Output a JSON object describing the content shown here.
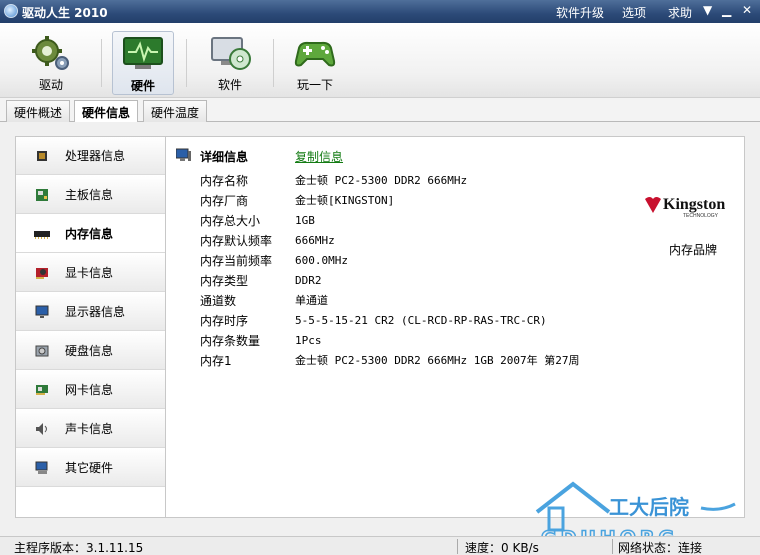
{
  "window": {
    "title": "驱动人生 2010",
    "menu": [
      "软件升级",
      "选项",
      "求助"
    ]
  },
  "toolbar": {
    "items": [
      {
        "label": "驱动",
        "icon": "gears-icon"
      },
      {
        "label": "硬件",
        "icon": "monitor-pulse-icon"
      },
      {
        "label": "软件",
        "icon": "monitor-disc-icon"
      },
      {
        "label": "玩一下",
        "icon": "gamepad-icon"
      }
    ],
    "active": "硬件"
  },
  "tabs": [
    "硬件概述",
    "硬件信息",
    "硬件温度"
  ],
  "sidebar": {
    "items": [
      {
        "label": "处理器信息",
        "icon": "cpu-icon"
      },
      {
        "label": "主板信息",
        "icon": "motherboard-icon"
      },
      {
        "label": "内存信息",
        "icon": "memory-icon"
      },
      {
        "label": "显卡信息",
        "icon": "graphics-card-icon"
      },
      {
        "label": "显示器信息",
        "icon": "display-icon"
      },
      {
        "label": "硬盘信息",
        "icon": "hard-disk-icon"
      },
      {
        "label": "网卡信息",
        "icon": "network-card-icon"
      },
      {
        "label": "声卡信息",
        "icon": "speaker-icon"
      },
      {
        "label": "其它硬件",
        "icon": "computer-icon"
      }
    ],
    "active": "内存信息"
  },
  "details": {
    "title": "详细信息",
    "copy_label": "复制信息",
    "rows": [
      {
        "label": "内存名称",
        "value": "金士顿 PC2-5300 DDR2 666MHz"
      },
      {
        "label": "内存厂商",
        "value": "金士顿[KINGSTON]"
      },
      {
        "label": "内存总大小",
        "value": "1GB"
      },
      {
        "label": "内存默认频率",
        "value": "666MHz"
      },
      {
        "label": "内存当前频率",
        "value": "600.0MHz"
      },
      {
        "label": "内存类型",
        "value": "DDR2"
      },
      {
        "label": "通道数",
        "value": "单通道"
      },
      {
        "label": "内存时序",
        "value": "5-5-5-15-21 CR2 (CL-RCD-RP-RAS-TRC-CR)"
      },
      {
        "label": "内存条数量",
        "value": "1Pcs"
      },
      {
        "label": "内存1",
        "value": "金士顿 PC2-5300 DDR2 666MHz 1GB 2007年 第27周"
      }
    ],
    "brand_logo_text": "Kingston",
    "brand_logo_subtext": "TECHNOLOGY",
    "brand_label": "内存品牌"
  },
  "status": {
    "version": "主程序版本：3.1.11.15",
    "speed": "速度：0 KB/s",
    "network": "网络状态：连接"
  },
  "watermark": {
    "text": "工大后院",
    "subtext": "GDUHORG"
  },
  "colors": {
    "link": "#137b13",
    "titlebar": "#2c4a78",
    "brand_red": "#c8102e"
  }
}
